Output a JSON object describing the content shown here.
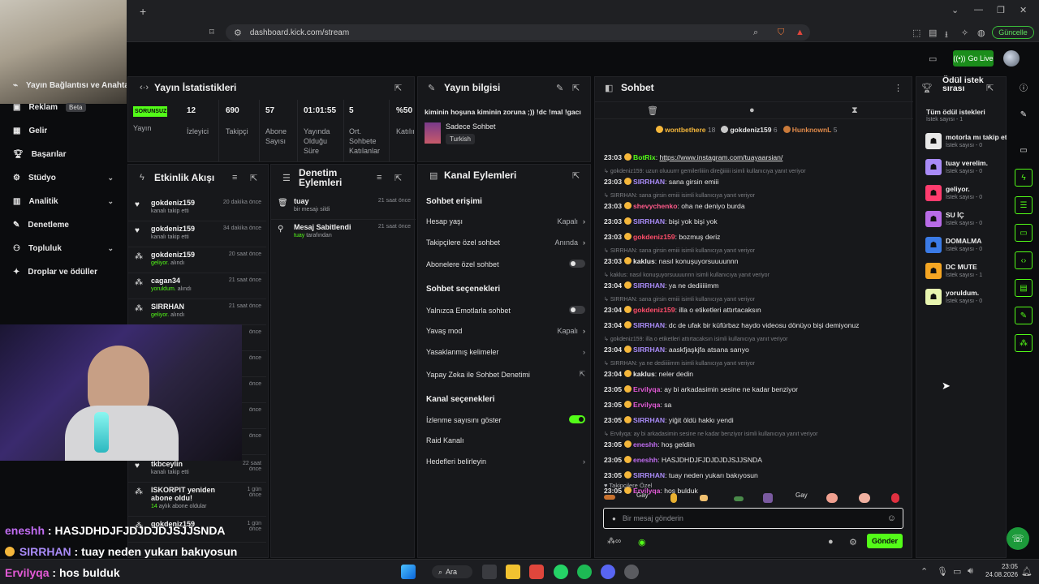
{
  "browser": {
    "url": "dashboard.kick.com/stream",
    "update_label": "Güncelle",
    "new_tab": "+"
  },
  "appbar": {
    "go_live_label": "Go Live"
  },
  "nav": {
    "items": [
      {
        "label": "Yayın Bağlantısı ve Anahtar",
        "icon": "key-icon"
      },
      {
        "label": "Reklam",
        "badge": "Beta",
        "icon": "ad-icon"
      },
      {
        "label": "Gelir",
        "icon": "wallet-icon"
      },
      {
        "label": "Başarılar",
        "icon": "trophy-icon"
      },
      {
        "label": "Stüdyo",
        "icon": "studio-icon",
        "expandable": true
      },
      {
        "label": "Analitik",
        "icon": "chart-icon",
        "expandable": true
      },
      {
        "label": "Denetleme",
        "icon": "wrench-icon"
      },
      {
        "label": "Topluluk",
        "icon": "community-icon",
        "expandable": true
      },
      {
        "label": "Droplar ve ödüller",
        "icon": "gift-icon"
      }
    ]
  },
  "stats": {
    "title": "Yayın İstatistikleri",
    "status": "SORUNSUZ",
    "status_label": "Yayın",
    "items": [
      {
        "value": "12",
        "label": "İzleyici"
      },
      {
        "value": "690",
        "label": "Takipçi"
      },
      {
        "value": "57",
        "label": "Abone Sayısı"
      },
      {
        "value": "01:01:55",
        "label": "Yayında Olduğu Süre"
      },
      {
        "value": "5",
        "label": "Ort. Sohbete Katılanlar"
      },
      {
        "value": "%50",
        "label": "Katılım"
      }
    ]
  },
  "events": {
    "title": "Etkinlik Akışı",
    "items": [
      {
        "name": "gokdeniz159",
        "sub": "kanalı takip etti",
        "time": "20 dakika önce",
        "icon": "heart-icon"
      },
      {
        "name": "gokdeniz159",
        "sub": "kanalı takip etti",
        "time": "34 dakika önce",
        "icon": "heart-icon"
      },
      {
        "name": "gokdeniz159",
        "sub_hl": "geliyor.",
        "sub": "alındı",
        "time": "20 saat önce",
        "icon": "reward-icon"
      },
      {
        "name": "cagan34",
        "sub_hl": "yoruldum.",
        "sub": "alındı",
        "time": "21 saat önce",
        "icon": "reward-icon"
      },
      {
        "name": "SIRRHAN",
        "sub_hl": "geliyor.",
        "sub": "alındı",
        "time": "21 saat önce",
        "icon": "reward-icon"
      }
    ],
    "partial": [
      {
        "time": "önce"
      },
      {
        "time": "önce"
      },
      {
        "time": "önce"
      },
      {
        "time": "önce"
      },
      {
        "time": "önce"
      }
    ],
    "bottom": [
      {
        "name": "tkbceylin",
        "sub": "kanalı takip etti",
        "time": "22 saat önce"
      },
      {
        "name": "ISKORPIT yeniden abone oldu!",
        "sub_hl": "14",
        "sub": "aylık abone oldular",
        "time": "1 gün önce"
      },
      {
        "name": "gokdeniz159",
        "time": "1 gün önce"
      }
    ]
  },
  "moderation": {
    "title": "Denetim Eylemleri",
    "items": [
      {
        "name": "tuay",
        "sub": "bir mesajı sildi",
        "time": "21 saat önce",
        "icon": "trash-icon"
      },
      {
        "name": "Mesaj Sabitlendi",
        "sub_hl": "tuay",
        "sub": "tarafından",
        "time": "21 saat önce",
        "icon": "pin-icon"
      }
    ]
  },
  "stream_info": {
    "title": "Yayın bilgisi",
    "stream_title": "kiminin hoşuna kiminin zoruna ;)) !dc !mal !gacı",
    "category": "Sadece Sohbet",
    "language": "Turkish"
  },
  "channel_actions": {
    "title": "Kanal Eylemleri",
    "chat_access_heading": "Sohbet erişimi",
    "chat_access": [
      {
        "label": "Hesap yaşı",
        "value": "Kapalı",
        "control": "arrow"
      },
      {
        "label": "Takipçilere özel sohbet",
        "value": "Anında",
        "control": "arrow",
        "value_color": "#53fc18"
      },
      {
        "label": "Abonelere özel sohbet",
        "control": "toggle",
        "on": false
      }
    ],
    "chat_options_heading": "Sohbet seçenekleri",
    "chat_options": [
      {
        "label": "Yalnızca Emotlarla sohbet",
        "control": "toggle",
        "on": false
      },
      {
        "label": "Yavaş mod",
        "value": "Kapalı",
        "control": "arrow"
      },
      {
        "label": "Yasaklanmış kelimeler",
        "control": "arrow"
      },
      {
        "label": "Yapay Zeka ile Sohbet Denetimi",
        "control": "external"
      }
    ],
    "channel_options_heading": "Kanal seçenekleri",
    "channel_options": [
      {
        "label": "İzlenme sayısını göster",
        "control": "toggle",
        "on": true
      },
      {
        "label": "Raid Kanalı",
        "control": "none"
      },
      {
        "label": "Hedefleri belirleyin",
        "control": "arrow"
      }
    ]
  },
  "chat": {
    "title": "Sohbet",
    "top_gifters": [
      {
        "name": "wontbethere",
        "count": "18",
        "color": "#f5b73b"
      },
      {
        "name": "gokdeniz159",
        "count": "6",
        "color": "#e6e6e6"
      },
      {
        "name": "HunknownL",
        "count": "5",
        "color": "#e08a4a"
      }
    ],
    "messages": [
      {
        "type": "msg",
        "ts": "23:03",
        "user": "BotRix",
        "color": "#53fc18",
        "text": "https://www.instagram.com/tuayaarsian/",
        "link": true
      },
      {
        "type": "reply",
        "text": "gokdeniz159: uzun oluuurrr gemilerliiiin direğiiiiii isimli kullanıcıya yanıt veriyor"
      },
      {
        "type": "msg",
        "ts": "23:03",
        "user": "SIRRHAN",
        "color": "#a98bf7",
        "text": "sana girsin emiii"
      },
      {
        "type": "reply",
        "text": "SIRRHAN: sana girsin emiii isimli kullanıcıya yanıt veriyor"
      },
      {
        "type": "msg",
        "ts": "23:03",
        "user": "shevychenko",
        "color": "#ff5a8a",
        "text": "oha ne deniyo burda"
      },
      {
        "type": "msg",
        "ts": "23:03",
        "user": "SIRRHAN",
        "color": "#a98bf7",
        "text": "bişi yok bişi yok"
      },
      {
        "type": "msg",
        "ts": "23:03",
        "user": "gokdeniz159",
        "color": "#ff4d6a",
        "text": "bozmuş deriz"
      },
      {
        "type": "reply",
        "text": "SIRRHAN: sana girsin emiii isimli kullanıcıya yanıt veriyor"
      },
      {
        "type": "msg",
        "ts": "23:03",
        "user": "kaklus",
        "color": "#e6e6e6",
        "text": "nasıl konuşuyorsuuuunnn"
      },
      {
        "type": "reply",
        "text": "kaklus: nasıl konuşuyorsuuuunnn isimli kullanıcıya yanıt veriyor"
      },
      {
        "type": "msg",
        "ts": "23:04",
        "user": "SIRRHAN",
        "color": "#a98bf7",
        "text": "ya ne dediiiiimm"
      },
      {
        "type": "reply",
        "text": "SIRRHAN: sana girsin emiii isimli kullanıcıya yanıt veriyor"
      },
      {
        "type": "msg",
        "ts": "23:04",
        "user": "gokdeniz159",
        "color": "#ff4d6a",
        "text": "illa o etiketleri attırtacaksın"
      },
      {
        "type": "msg",
        "ts": "23:04",
        "user": "SIRRHAN",
        "color": "#a98bf7",
        "text": "dc de ufak bir küfürbaz haydo videosu dönüyo bişi demiyonuz"
      },
      {
        "type": "reply",
        "text": "gokdeniz159: illa o etiketleri attırtacaksın isimli kullanıcıya yanıt veriyor"
      },
      {
        "type": "msg",
        "ts": "23:04",
        "user": "SIRRHAN",
        "color": "#a98bf7",
        "text": "aaskfjaşkjfa atsana sarıyo"
      },
      {
        "type": "reply",
        "text": "SIRRHAN: ya ne dediiiiimm isimli kullanıcıya yanıt veriyor"
      },
      {
        "type": "msg",
        "ts": "23:04",
        "user": "kaklus",
        "color": "#e6e6e6",
        "text": "neler dedin"
      },
      {
        "type": "msg",
        "ts": "23:05",
        "user": "Ervilyqa",
        "color": "#e35ad6",
        "text": "ay bi arkadasimin sesine ne kadar benziyor"
      },
      {
        "type": "msg",
        "ts": "23:05",
        "user": "Ervilyqa",
        "color": "#e35ad6",
        "text": "sa"
      },
      {
        "type": "msg",
        "ts": "23:05",
        "user": "SIRRHAN",
        "color": "#a98bf7",
        "text": "yiğit öldü hakkı yendi"
      },
      {
        "type": "reply",
        "text": "Ervilyqa: ay bi arkadasimin sesine ne kadar benziyor isimli kullanıcıya yanıt veriyor"
      },
      {
        "type": "msg",
        "ts": "23:05",
        "user": "eneshh",
        "color": "#c06cf0",
        "text": "hoş geldiin"
      },
      {
        "type": "msg",
        "ts": "23:05",
        "user": "eneshh",
        "color": "#c06cf0",
        "text": "HASJDHDJFJDJDJDJSJJSNDA"
      },
      {
        "type": "msg",
        "ts": "23:05",
        "user": "SIRRHAN",
        "color": "#a98bf7",
        "text": "tuay neden yukarı bakıyosun"
      },
      {
        "type": "msg",
        "ts": "23:05",
        "user": "Ervilyqa",
        "color": "#e35ad6",
        "text": "hos bulduk"
      }
    ],
    "followers_only": "Takipçilere Özel",
    "input_placeholder": "Bir mesaj gönderin",
    "send_label": "Gönder",
    "emote_labels": [
      "Gay",
      "Gay"
    ]
  },
  "rewards": {
    "title": "Ödül istek sırası",
    "all_label": "Tüm ödül istekleri",
    "all_count": "İstek sayısı - 1",
    "items": [
      {
        "name": "motorla mı takip et",
        "count": "İstek sayısı - 0",
        "color": "#e8e8e8"
      },
      {
        "name": "tuay verelim.",
        "count": "İstek sayısı - 0",
        "color": "#a98bf7"
      },
      {
        "name": "geliyor.",
        "count": "İstek sayısı - 0",
        "color": "#ff3c6e"
      },
      {
        "name": "SU İÇ",
        "count": "İstek sayısı - 0",
        "color": "#b86be6"
      },
      {
        "name": "DOMALMA",
        "count": "İstek sayısı - 0",
        "color": "#3b7be6"
      },
      {
        "name": "DC MUTE",
        "count": "İstek sayısı - 1",
        "color": "#f5a623"
      },
      {
        "name": "yoruldum.",
        "count": "İstek sayısı - 0",
        "color": "#e8f5b0"
      }
    ]
  },
  "overlay_chat": [
    {
      "user": "eneshh",
      "color": "#c06cf0",
      "text": "HASJDHDJFJDJDJDJSJJSNDA"
    },
    {
      "user": "SIRRHAN",
      "color": "#a98bf7",
      "text": "tuay neden yukarı bakıyosun"
    },
    {
      "user": "Ervilyqa",
      "color": "#e35ad6",
      "text": "hos bulduk"
    }
  ],
  "taskbar": {
    "search_label": "Ara",
    "time": "23:05",
    "date": "24.08.2026"
  }
}
